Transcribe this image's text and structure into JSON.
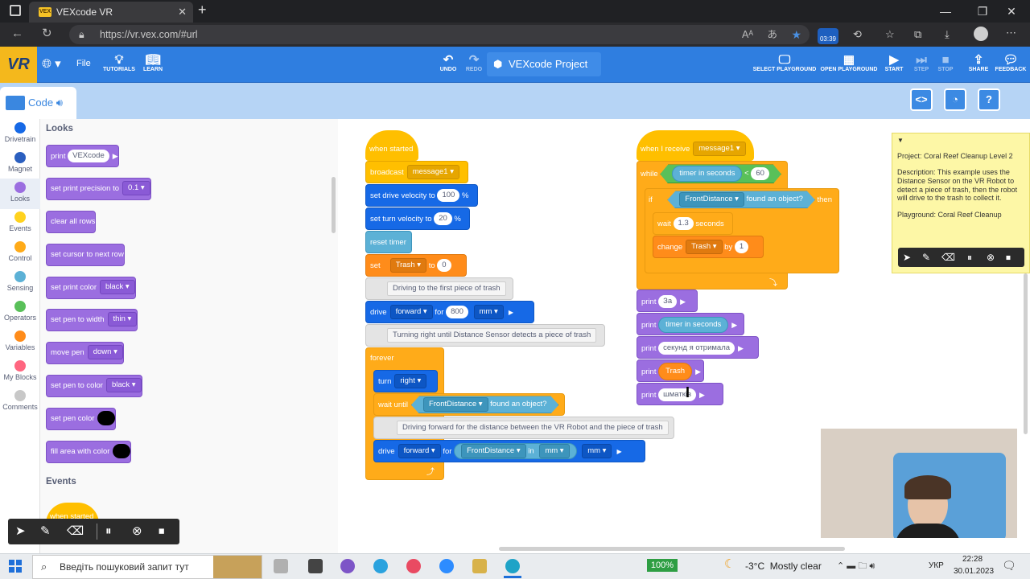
{
  "browser": {
    "tab_title": "VEXcode VR",
    "tab_favicon": "VEX",
    "url": "https://vr.vex.com/#url",
    "timer_badge": "03:39"
  },
  "header": {
    "logo": "VR",
    "file": "File",
    "tutorials": "TUTORIALS",
    "learn": "LEARN",
    "undo": "UNDO",
    "redo": "REDO",
    "project": "VEXcode Project",
    "select_playground": "SELECT PLAYGROUND",
    "open_playground": "OPEN PLAYGROUND",
    "start": "START",
    "step": "STEP",
    "stop": "STOP",
    "share": "SHARE",
    "feedback": "FEEDBACK"
  },
  "code_tab": "Code",
  "categories": [
    {
      "label": "Drivetrain",
      "color": "#1669e6"
    },
    {
      "label": "Magnet",
      "color": "#2b5fbf"
    },
    {
      "label": "Looks",
      "color": "#9b6ee0"
    },
    {
      "label": "Events",
      "color": "#ffd21e"
    },
    {
      "label": "Control",
      "color": "#ffab19"
    },
    {
      "label": "Sensing",
      "color": "#5cb1d6"
    },
    {
      "label": "Operators",
      "color": "#59c059"
    },
    {
      "label": "Variables",
      "color": "#ff8c1a"
    },
    {
      "label": "My Blocks",
      "color": "#ff6680"
    },
    {
      "label": "Comments",
      "color": "#c8c8c8"
    }
  ],
  "palette": {
    "section_looks": "Looks",
    "section_events": "Events",
    "print": "print",
    "print_value": "VEXcode",
    "set_precision": "set print precision to",
    "precision_value": "0.1",
    "clear_rows": "clear all rows",
    "next_row": "set cursor to next row",
    "print_color": "set print color",
    "print_color_value": "black",
    "pen_width": "set pen to width",
    "pen_width_value": "thin",
    "move_pen": "move pen",
    "move_pen_value": "down",
    "pen_color": "set pen to color",
    "pen_color_value": "black",
    "set_pen_color": "set pen color",
    "fill_area": "fill area with color",
    "when_started": "when started"
  },
  "script1": {
    "when_started": "when started",
    "broadcast": "broadcast",
    "message": "message1",
    "set_drive_velocity": "set drive velocity to",
    "drive_velocity": "100",
    "pct": "%",
    "set_turn_velocity": "set turn velocity to",
    "turn_velocity": "20",
    "reset_timer": "reset timer",
    "set": "set",
    "var": "Trash",
    "to": "to",
    "zero": "0",
    "comment1": "Driving to the first piece of trash",
    "drive": "drive",
    "forward": "forward",
    "for": "for",
    "dist": "800",
    "mm": "mm",
    "comment2": "Turning right until Distance Sensor detects a piece of trash",
    "forever": "forever",
    "turn": "turn",
    "right": "right",
    "wait_until": "wait until",
    "sensor": "FrontDistance",
    "found": "found an object?",
    "comment3": "Driving forward for the distance between the VR Robot and the piece of trash",
    "in": "in"
  },
  "script2": {
    "when_receive": "when I receive",
    "message": "message1",
    "while": "while",
    "timer": "timer in seconds",
    "lt": "<",
    "sixty": "60",
    "if": "if",
    "sensor": "FrontDistance",
    "found": "found an object?",
    "then": "then",
    "wait": "wait",
    "wait_value": "1.3",
    "seconds": "seconds",
    "change": "change",
    "var": "Trash",
    "by": "by",
    "one": "1",
    "print": "print",
    "p1": "За",
    "p3": "секунд я отримала",
    "p5": "шматків"
  },
  "note": {
    "title": "Project: Coral Reef Cleanup Level 2",
    "desc": "Description: This example uses the Distance Sensor on the VR Robot to detect a piece of trash, then the robot will drive to the trash to collect it.",
    "playground": "Playground: Coral Reef Cleanup"
  },
  "taskbar": {
    "search_placeholder": "Введіть пошуковий запит тут",
    "battery": "100%",
    "weather": "-3°C  Mostly clear",
    "lang": "УКР",
    "time": "22:28",
    "date": "30.01.2023"
  }
}
